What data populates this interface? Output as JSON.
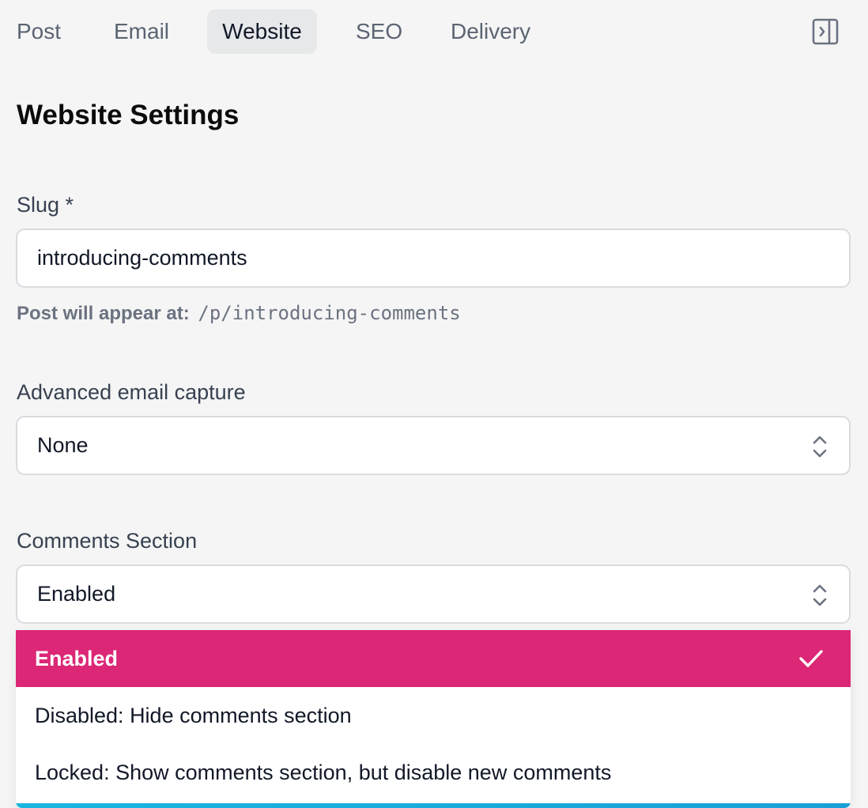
{
  "tabs": [
    {
      "label": "Post",
      "active": false
    },
    {
      "label": "Email",
      "active": false
    },
    {
      "label": "Website",
      "active": true
    },
    {
      "label": "SEO",
      "active": false
    },
    {
      "label": "Delivery",
      "active": false
    }
  ],
  "toolbar": {
    "panel_toggle_icon": "sidebar-collapse-icon"
  },
  "page": {
    "heading": "Website Settings"
  },
  "slug": {
    "label": "Slug *",
    "value": "introducing-comments",
    "hint_label": "Post will appear at:",
    "hint_path": "/p/introducing-comments"
  },
  "email_capture": {
    "label": "Advanced email capture",
    "value": "None"
  },
  "comments": {
    "label": "Comments Section",
    "value": "Enabled",
    "options": [
      {
        "label": "Enabled",
        "selected": true
      },
      {
        "label": "Disabled: Hide comments section",
        "selected": false
      },
      {
        "label": "Locked: Show comments section, but disable new comments",
        "selected": false
      }
    ]
  },
  "colors": {
    "accent": "#dc2776",
    "active_tab_bg": "#e7e8ea",
    "background": "#f5f5f5"
  }
}
